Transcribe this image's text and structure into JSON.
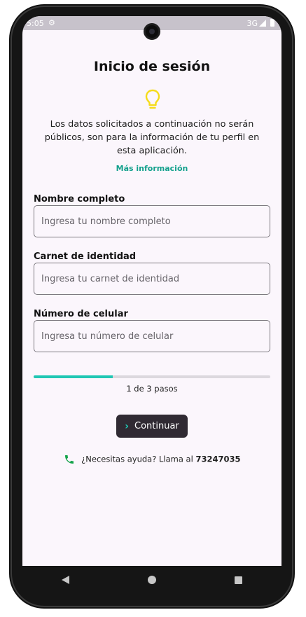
{
  "status": {
    "time": "5:05",
    "network": "3G",
    "gear_icon": "gear-icon",
    "signal_icon": "signal-icon",
    "battery_icon": "battery-icon"
  },
  "header": {
    "title": "Inicio de sesión",
    "bulb_icon": "lightbulb-icon"
  },
  "intro": {
    "description": "Los datos solicitados a continuación no serán públicos, son para la información de tu perfil en esta aplicación.",
    "more_info_link": "Más información"
  },
  "form": {
    "fields": [
      {
        "label": "Nombre completo",
        "placeholder": "Ingresa tu nombre completo",
        "value": ""
      },
      {
        "label": "Carnet de identidad",
        "placeholder": "Ingresa tu carnet de identidad",
        "value": ""
      },
      {
        "label": "Número de celular",
        "placeholder": "Ingresa tu número de celular",
        "value": ""
      }
    ]
  },
  "progress": {
    "text": "1 de 3 pasos",
    "current": 1,
    "total": 3,
    "fraction": 0.333
  },
  "actions": {
    "continue_label": "Continuar"
  },
  "help": {
    "text": "¿Necesitas ayuda? Llama al ",
    "number": "73247035",
    "icon": "phone-icon"
  },
  "colors": {
    "accent": "#21c7b4",
    "link": "#12a08c",
    "bulb": "#f5dc1a",
    "phone_icon": "#14a34a",
    "button_bg": "#302a33",
    "screen_bg": "#fbf6fc"
  }
}
